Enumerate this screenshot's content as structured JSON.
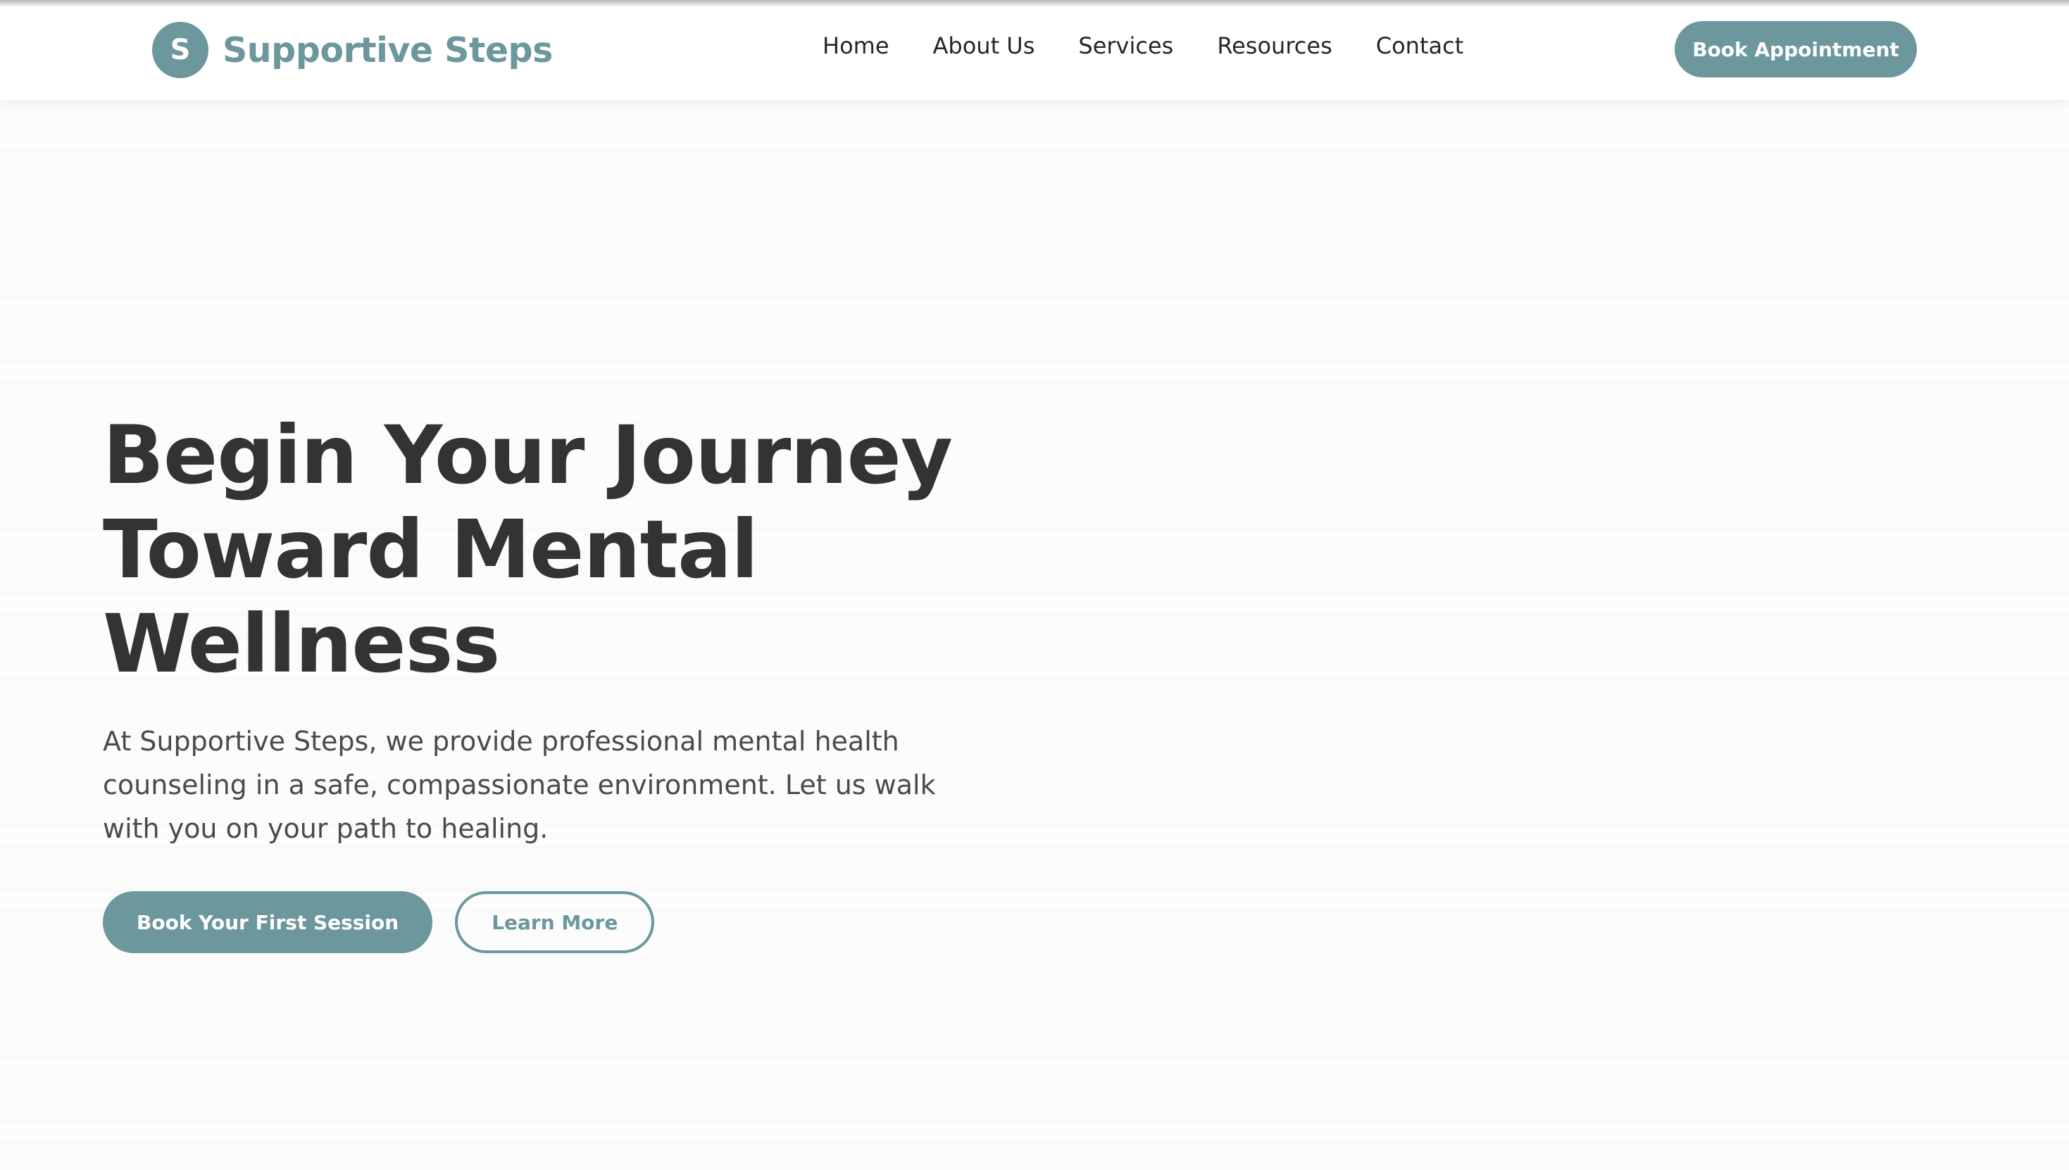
{
  "brand": {
    "mark_letter": "S",
    "name": "Supportive Steps"
  },
  "nav": {
    "items": [
      {
        "label": "Home"
      },
      {
        "label": "About Us"
      },
      {
        "label": "Services"
      },
      {
        "label": "Resources"
      },
      {
        "label": "Contact"
      }
    ]
  },
  "header": {
    "cta_label": "Book Appointment"
  },
  "hero": {
    "title_line1": "Begin Your Journey",
    "title_line2": "Toward Mental",
    "title_line3": "Wellness",
    "description": "At Supportive Steps, we provide professional mental health counseling in a safe, compassionate environment. Let us walk with you on your path to healing.",
    "primary_button": "Book Your First Session",
    "secondary_button": "Learn More"
  },
  "colors": {
    "accent": "#6b979d",
    "heading": "#333333",
    "body_text": "#4a4a4a",
    "background": "#fcfcfc"
  }
}
